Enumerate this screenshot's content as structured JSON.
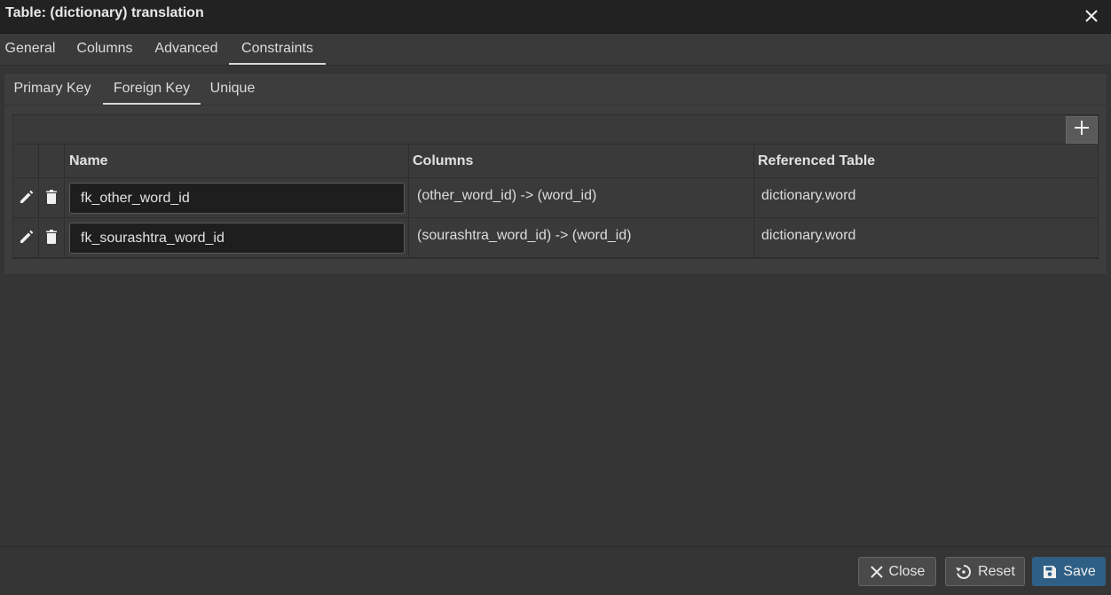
{
  "dialog": {
    "title": "Table: (dictionary) translation"
  },
  "tabs": [
    {
      "label": "General"
    },
    {
      "label": "Columns"
    },
    {
      "label": "Advanced"
    },
    {
      "label": "Constraints",
      "active": true
    }
  ],
  "subtabs": [
    {
      "label": "Primary Key"
    },
    {
      "label": "Foreign Key",
      "active": true
    },
    {
      "label": "Unique"
    }
  ],
  "grid": {
    "columns": [
      "Name",
      "Columns",
      "Referenced Table"
    ],
    "rows": [
      {
        "name": "fk_other_word_id",
        "columns": "(other_word_id) -> (word_id)",
        "referenced_table": "dictionary.word"
      },
      {
        "name": "fk_sourashtra_word_id",
        "columns": "(sourashtra_word_id) -> (word_id)",
        "referenced_table": "dictionary.word"
      }
    ],
    "icons": {
      "add": "plus-icon",
      "edit": "pencil-icon",
      "delete": "trash-icon"
    }
  },
  "footer": {
    "close_label": "Close",
    "reset_label": "Reset",
    "save_label": "Save"
  },
  "colors": {
    "background": "#353535",
    "titlebar": "#222222",
    "primary_button": "#2f5f85"
  }
}
